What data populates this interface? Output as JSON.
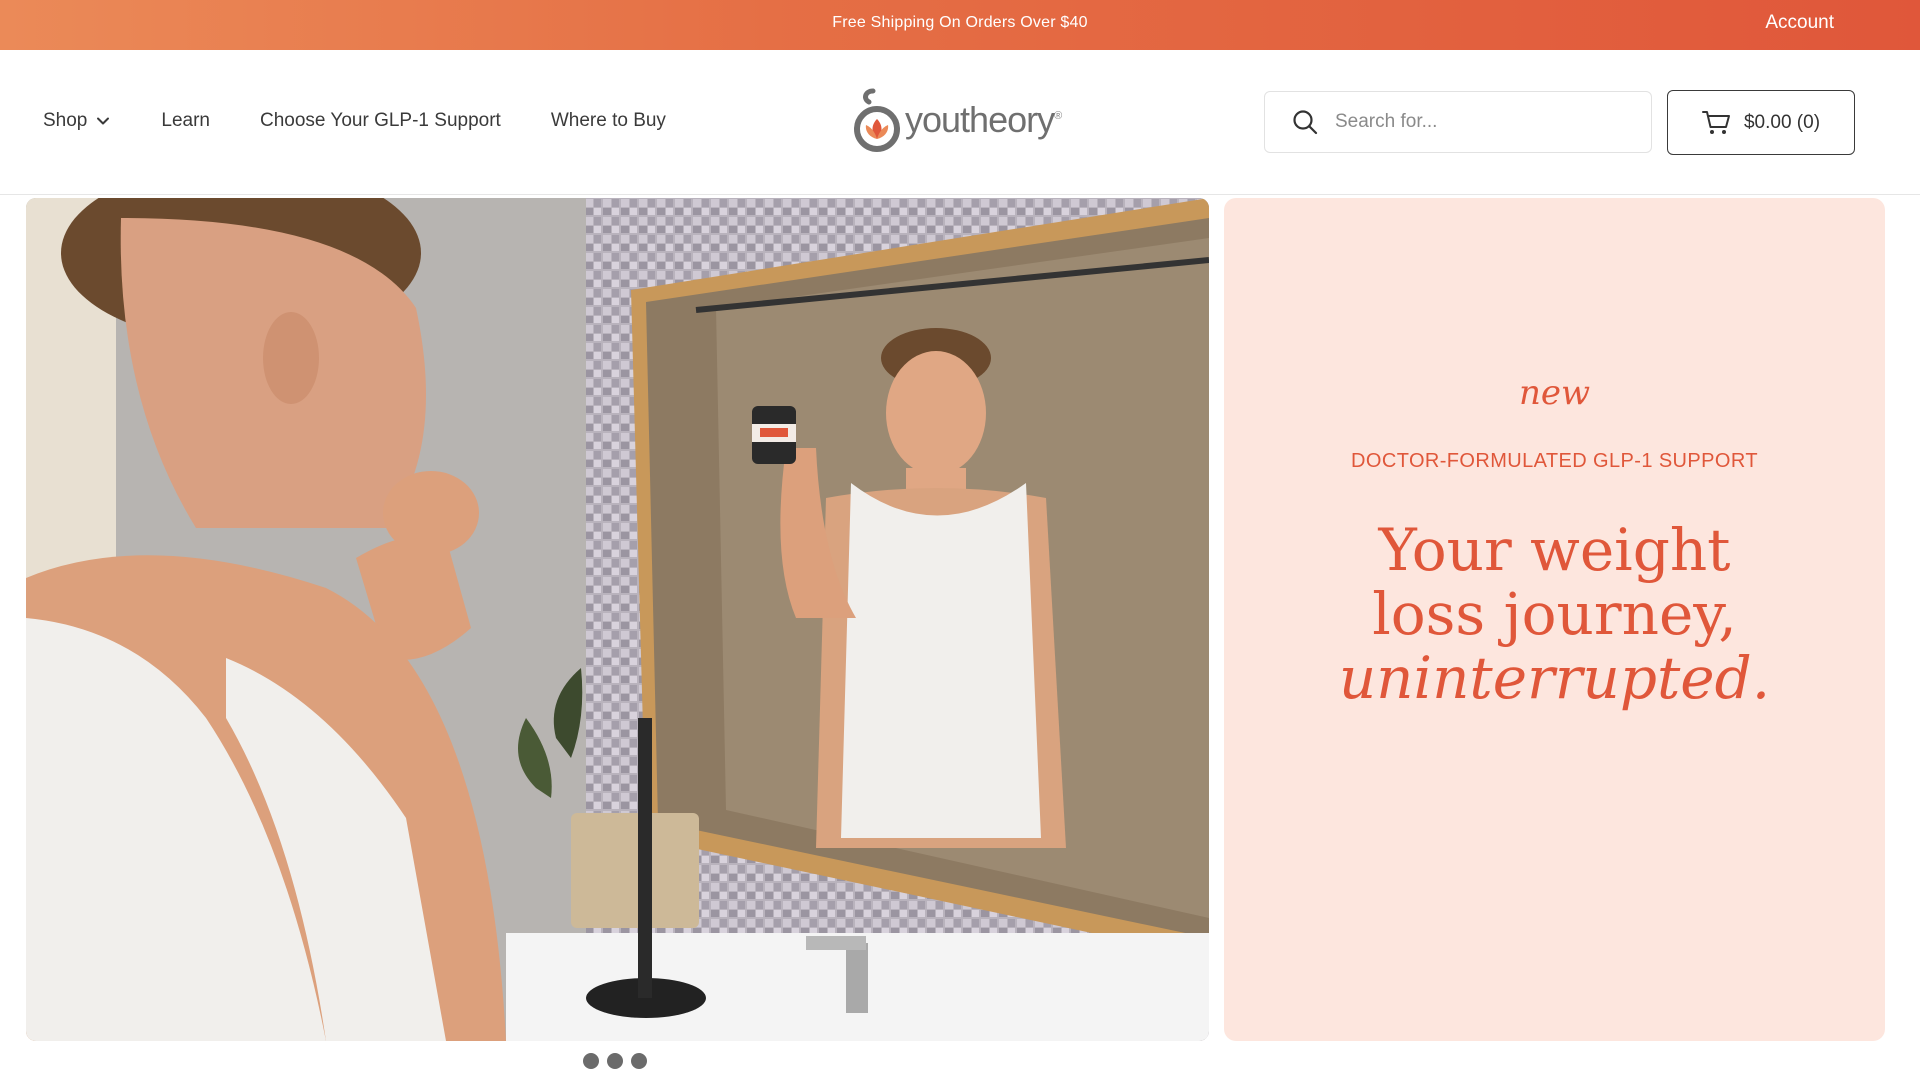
{
  "promo": {
    "text": "Free Shipping On Orders Over $40",
    "account_label": "Account"
  },
  "nav": {
    "items": [
      {
        "label": "Shop",
        "has_dropdown": true
      },
      {
        "label": "Learn"
      },
      {
        "label": "Choose Your GLP-1 Support"
      },
      {
        "label": "Where to Buy"
      }
    ]
  },
  "logo": {
    "wordmark": "youtheory",
    "trademark": "®"
  },
  "search": {
    "placeholder": "Search for..."
  },
  "cart": {
    "label": "$0.00 (0)"
  },
  "hero": {
    "image_icon": "bathroom-mirror-photo",
    "panel": {
      "eyebrow": "new",
      "subtitle": "DOCTOR-FORMULATED GLP-1 SUPPORT",
      "headline_line1": "Your weight",
      "headline_line2": "loss journey,",
      "headline_line3": "uninterrupted."
    },
    "carousel": {
      "slide_count": 3
    }
  },
  "colors": {
    "accent": "#e0573a",
    "panel_bg": "#fde6de",
    "promo_start": "#eb8a58"
  }
}
